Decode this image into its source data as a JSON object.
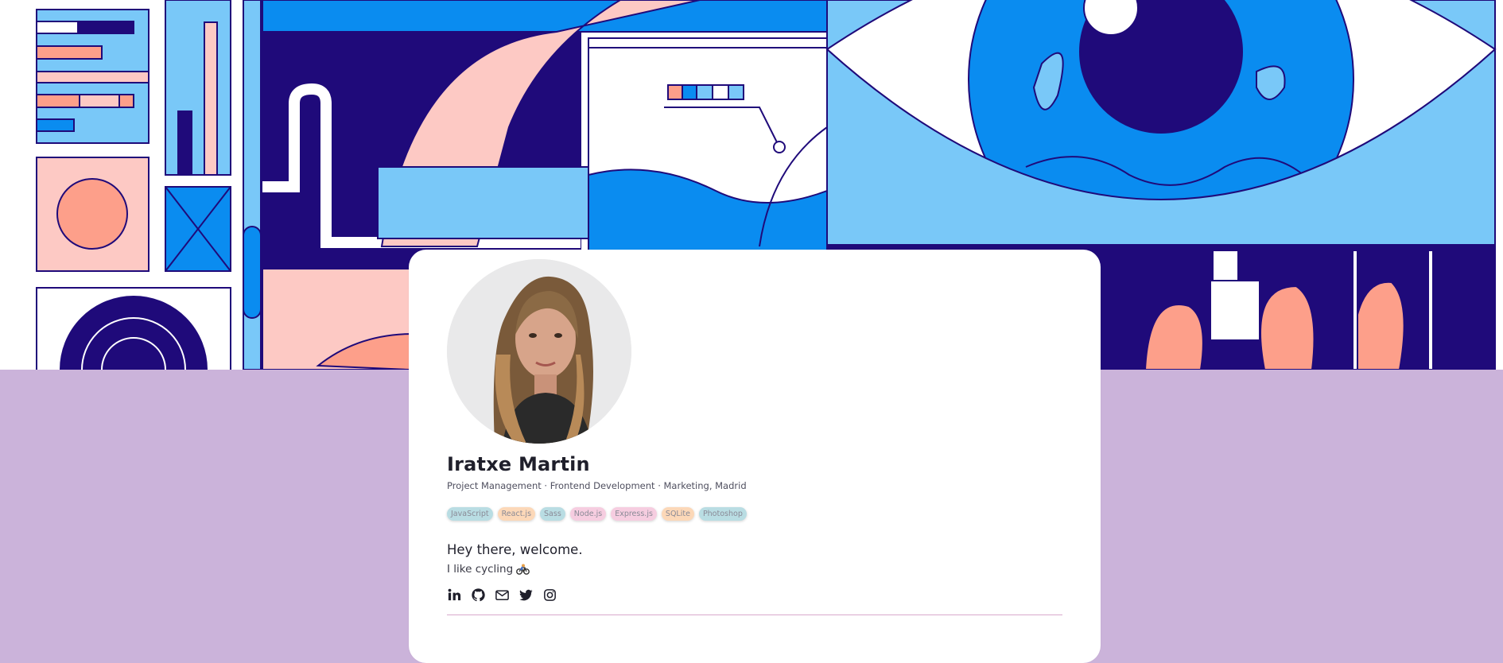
{
  "profile": {
    "name": "Iratxe Martin",
    "subtitle": "Project Management · Frontend Development · Marketing, Madrid",
    "greeting": "Hey there, welcome.",
    "hobby": "I like cycling"
  },
  "tags": [
    {
      "label": "JavaScript",
      "color": "#b9dde3"
    },
    {
      "label": "React.js",
      "color": "#fcd8b8"
    },
    {
      "label": "Sass",
      "color": "#b9dde3"
    },
    {
      "label": "Node.js",
      "color": "#f6cde0"
    },
    {
      "label": "Express.js",
      "color": "#f6cde0"
    },
    {
      "label": "SQLite",
      "color": "#fcd8b8"
    },
    {
      "label": "Photoshop",
      "color": "#b9dde3"
    }
  ],
  "socials": [
    "linkedin-icon",
    "github-icon",
    "mail-icon",
    "twitter-icon",
    "instagram-icon"
  ],
  "colors": {
    "page_background": "#cbb3da",
    "banner_navy": "#1f0a7a",
    "banner_blue": "#0a8cf0",
    "banner_light_blue": "#79c8f8",
    "banner_pink": "#fdc9c4",
    "banner_salmon": "#fd9f8a",
    "divider": "#d9a9cc"
  }
}
